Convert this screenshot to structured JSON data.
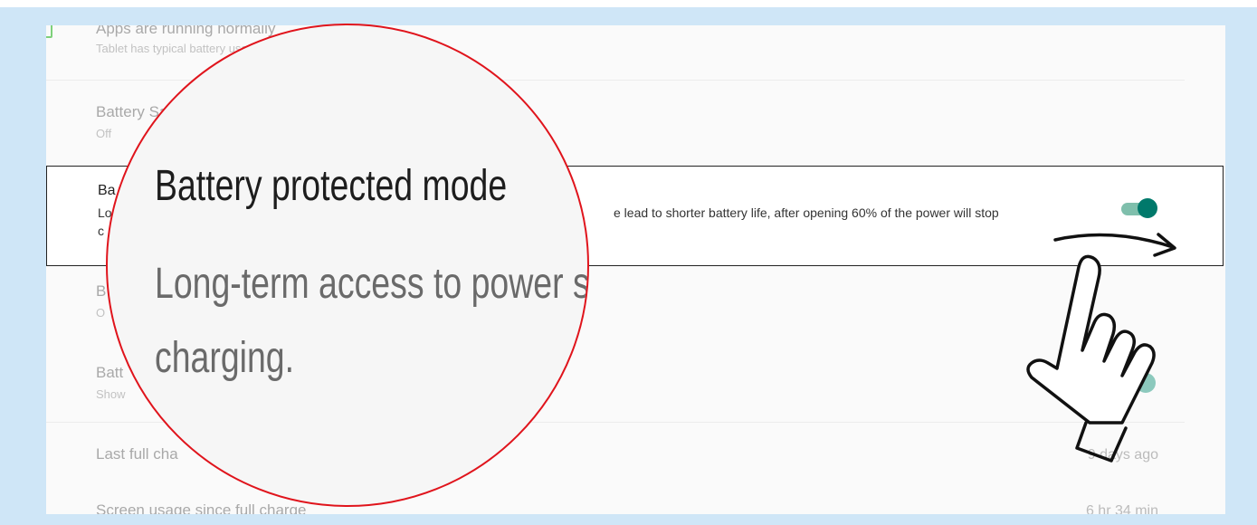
{
  "settings": {
    "apps_status": {
      "title": "Apps are running normally",
      "subtitle": "Tablet has typical battery usage"
    },
    "battery_saver": {
      "title": "Battery Saver",
      "subtitle": "Off"
    },
    "battery_protected": {
      "title": "Battery protected mode",
      "desc_part1": "Lo",
      "desc_part2": "c",
      "desc_visible": "e lead to shorter battery life, after opening 60% of the power will stop",
      "toggle_on": true
    },
    "row4": {
      "title": "B",
      "subtitle": "O"
    },
    "battery_percentage": {
      "title": "Batt",
      "subtitle": "Show"
    },
    "last_full_charge": {
      "title": "Last full cha",
      "value": "9 days ago"
    },
    "screen_usage": {
      "title": "Screen usage since full charge",
      "value": "6 hr 34 min"
    }
  },
  "magnifier": {
    "title": "Battery protected mode",
    "desc_line1": "Long-term access to power supp",
    "desc_line2": "charging."
  },
  "colors": {
    "toggle_track": "#7fbfac",
    "toggle_knob": "#00796b",
    "toggle_track_faded": "#d7ebe5",
    "toggle_knob_faded": "#8cc9bd",
    "magnifier_border": "#e0141c"
  },
  "icons": {
    "gesture": "swipe-right-hand-icon",
    "arrow": "arrow-right-icon",
    "check": "battery-ok-icon"
  }
}
